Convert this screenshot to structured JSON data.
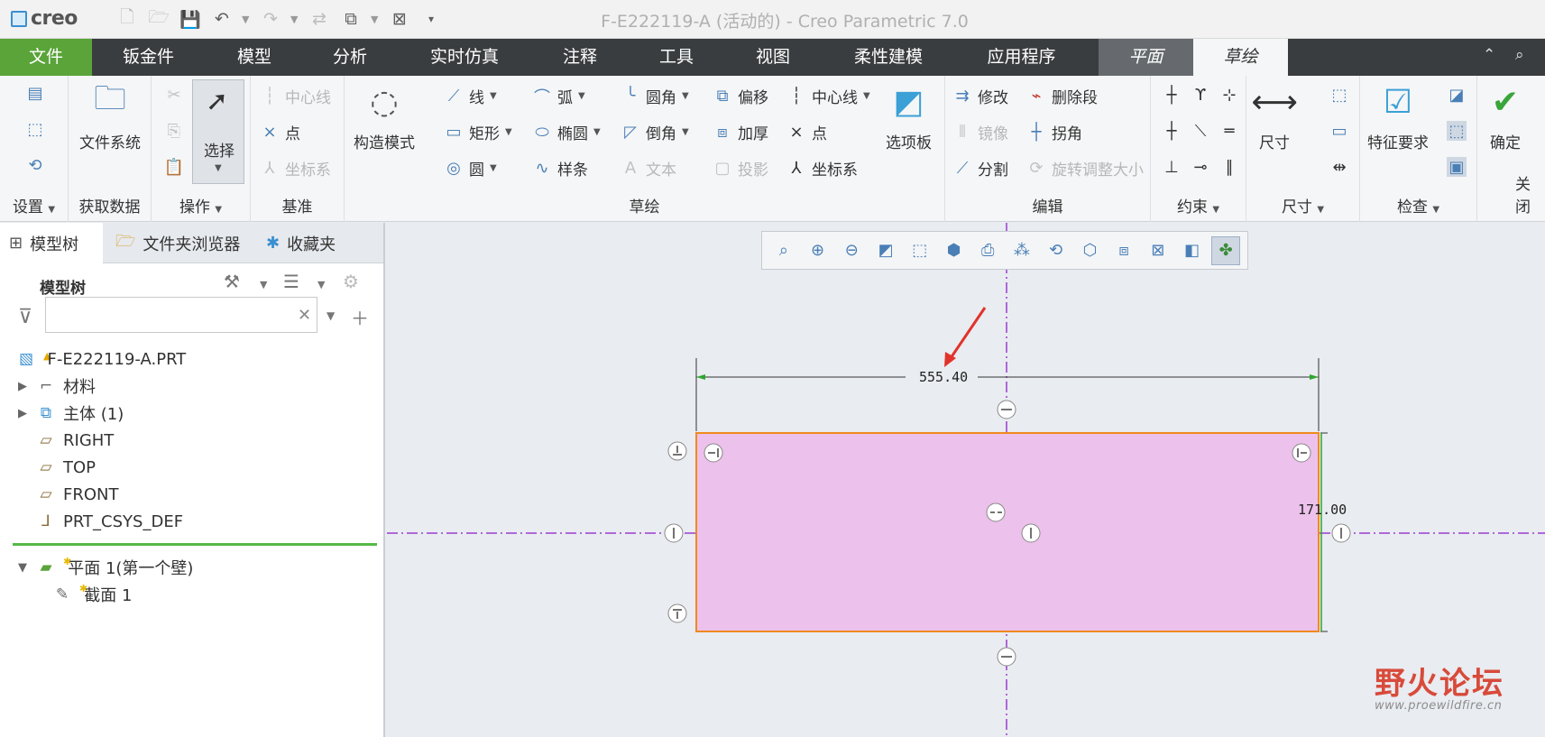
{
  "titlebar": {
    "logo_text": "creo",
    "window_title": "F-E222119-A (活动的) - Creo Parametric 7.0"
  },
  "menu": {
    "tabs": [
      "文件",
      "钣金件",
      "模型",
      "分析",
      "实时仿真",
      "注释",
      "工具",
      "视图",
      "柔性建模",
      "应用程序",
      "平面",
      "草绘"
    ]
  },
  "ribbon": {
    "setup": {
      "label": "设置"
    },
    "get_data": {
      "file_system": "文件系统",
      "label": "获取数据"
    },
    "operations": {
      "select": "选择",
      "label": "操作"
    },
    "datum": {
      "centerline": "中心线",
      "point": "点",
      "csys": "坐标系",
      "label": "基准"
    },
    "sketch": {
      "construction_mode": "构造模式",
      "line": "线",
      "rectangle": "矩形",
      "circle": "圆",
      "arc": "弧",
      "ellipse": "椭圆",
      "spline": "样条",
      "fillet": "圆角",
      "chamfer": "倒角",
      "text": "文本",
      "offset": "偏移",
      "thicken": "加厚",
      "project": "投影",
      "centerline": "中心线",
      "point": "点",
      "csys": "坐标系",
      "palette": "选项板",
      "label": "草绘"
    },
    "edit": {
      "modify": "修改",
      "delete_segment": "删除段",
      "mirror": "镜像",
      "corner": "拐角",
      "divide": "分割",
      "rotate_resize": "旋转调整大小",
      "label": "编辑"
    },
    "constrain": {
      "label": "约束"
    },
    "dimension": {
      "dimension": "尺寸",
      "label": "尺寸"
    },
    "inspect": {
      "feature_requirements": "特征要求",
      "label": "检查"
    },
    "close": {
      "ok": "确定",
      "label": "关闭"
    }
  },
  "left_panel": {
    "tabs": [
      "模型树",
      "文件夹浏览器",
      "收藏夹"
    ],
    "tree_header": "模型树",
    "filter_placeholder": "",
    "tree": [
      {
        "label": "F-E222119-A.PRT",
        "icon": "part-icon"
      },
      {
        "label": "材料",
        "icon": "material-icon"
      },
      {
        "label": "主体 (1)",
        "icon": "body-icon"
      },
      {
        "label": "RIGHT",
        "icon": "datum-plane-icon"
      },
      {
        "label": "TOP",
        "icon": "datum-plane-icon"
      },
      {
        "label": "FRONT",
        "icon": "datum-plane-icon"
      },
      {
        "label": "PRT_CSYS_DEF",
        "icon": "csys-icon"
      }
    ],
    "feature_tree": [
      {
        "label": "平面 1(第一个壁)",
        "icon": "planar-wall-icon"
      },
      {
        "label": "截面 1",
        "icon": "section-icon"
      }
    ]
  },
  "sketch": {
    "width_dimension": "555.40",
    "height_dimension": "171.00",
    "fill_color": "#ecc1eb",
    "outline_color": "#ef8a1e",
    "centerline_color": "#9b3dd0",
    "arrow_color": "#e0332b"
  },
  "watermark": {
    "title": "野火论坛",
    "url": "www.proewildfire.cn"
  }
}
